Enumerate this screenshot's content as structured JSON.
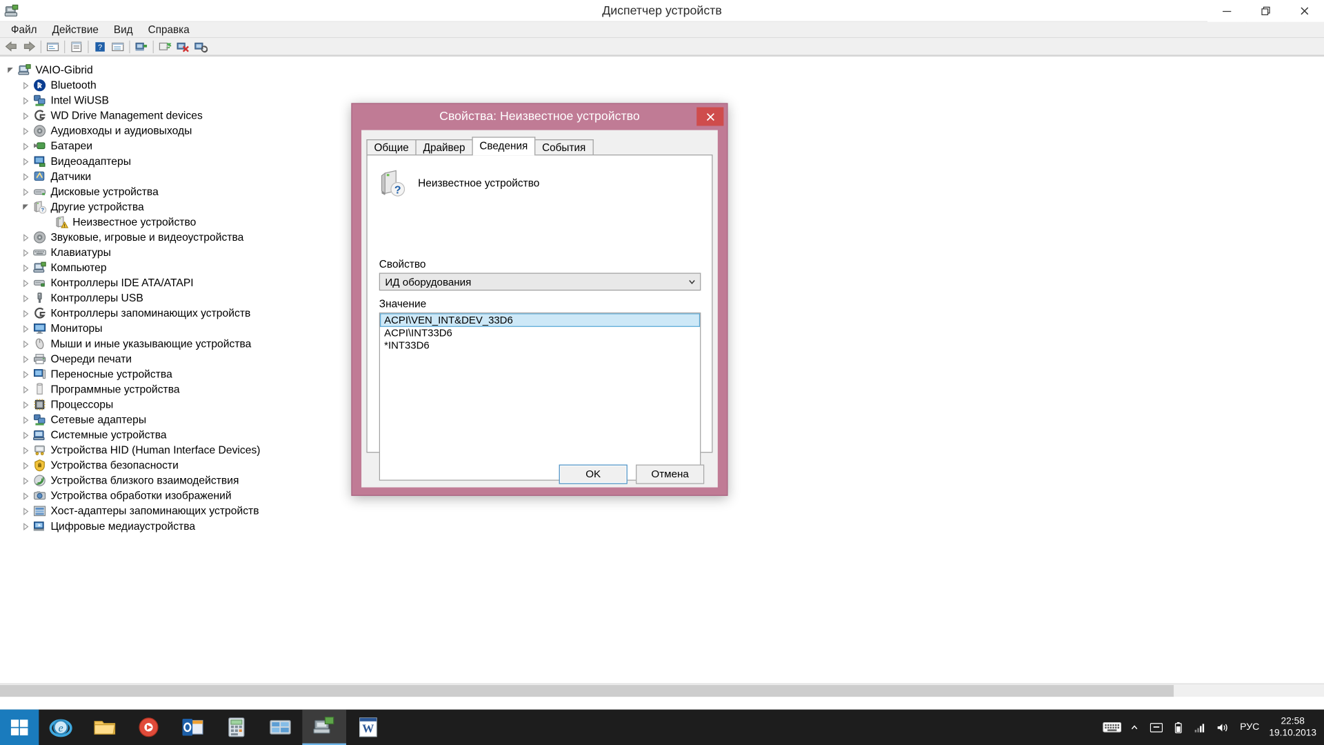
{
  "window": {
    "title": "Диспетчер устройств",
    "icon": "device-manager-icon",
    "minimize_label": "—",
    "restore_label": "❐",
    "close_label": "✕"
  },
  "menubar": {
    "items": [
      {
        "label": "Файл",
        "name": "menu-file"
      },
      {
        "label": "Действие",
        "name": "menu-action"
      },
      {
        "label": "Вид",
        "name": "menu-view"
      },
      {
        "label": "Справка",
        "name": "menu-help"
      }
    ]
  },
  "toolbar": {
    "buttons": [
      {
        "name": "back-icon",
        "title": "Назад"
      },
      {
        "name": "forward-icon",
        "title": "Вперед"
      },
      {
        "name": "show-hide-console-tree-icon",
        "title": "Показать/скрыть дерево консоли"
      },
      {
        "name": "properties-icon",
        "title": "Свойства"
      },
      {
        "name": "help-icon",
        "title": "Справка"
      },
      {
        "name": "show-hide-pane-icon",
        "title": "Показать/скрыть область"
      },
      {
        "name": "scan-hardware-changes-icon",
        "title": "Обновить конфигурацию оборудования"
      },
      {
        "name": "update-driver-icon",
        "title": "Обновить драйверы"
      },
      {
        "name": "disable-device-icon",
        "title": "Отключить устройство"
      },
      {
        "name": "uninstall-device-icon",
        "title": "Удалить устройство"
      }
    ]
  },
  "tree": {
    "nodes": [
      {
        "label": "VAIO-Gibrid",
        "level": 0,
        "expander": "expanded",
        "icon": "computer-icon"
      },
      {
        "label": "Bluetooth",
        "level": 1,
        "expander": "collapsed",
        "icon": "bluetooth-icon"
      },
      {
        "label": "Intel WiUSB",
        "level": 1,
        "expander": "collapsed",
        "icon": "network-adapter-icon"
      },
      {
        "label": "WD Drive Management devices",
        "level": 1,
        "expander": "collapsed",
        "icon": "storage-controller-icon"
      },
      {
        "label": "Аудиовходы и аудиовыходы",
        "level": 1,
        "expander": "collapsed",
        "icon": "audio-icon"
      },
      {
        "label": "Батареи",
        "level": 1,
        "expander": "collapsed",
        "icon": "battery-icon"
      },
      {
        "label": "Видеоадаптеры",
        "level": 1,
        "expander": "collapsed",
        "icon": "display-adapter-icon"
      },
      {
        "label": "Датчики",
        "level": 1,
        "expander": "collapsed",
        "icon": "sensor-icon"
      },
      {
        "label": "Дисковые устройства",
        "level": 1,
        "expander": "collapsed",
        "icon": "disk-drive-icon"
      },
      {
        "label": "Другие устройства",
        "level": 1,
        "expander": "expanded",
        "icon": "other-device-icon"
      },
      {
        "label": "Неизвестное устройство",
        "level": 2,
        "expander": "none",
        "icon": "unknown-device-icon",
        "selected": false
      },
      {
        "label": "Звуковые, игровые и видеоустройства",
        "level": 1,
        "expander": "collapsed",
        "icon": "audio-icon"
      },
      {
        "label": "Клавиатуры",
        "level": 1,
        "expander": "collapsed",
        "icon": "keyboard-icon"
      },
      {
        "label": "Компьютер",
        "level": 1,
        "expander": "collapsed",
        "icon": "computer-icon"
      },
      {
        "label": "Контроллеры IDE ATA/ATAPI",
        "level": 1,
        "expander": "collapsed",
        "icon": "ide-controller-icon"
      },
      {
        "label": "Контроллеры USB",
        "level": 1,
        "expander": "collapsed",
        "icon": "usb-icon"
      },
      {
        "label": "Контроллеры запоминающих устройств",
        "level": 1,
        "expander": "collapsed",
        "icon": "storage-controller-icon"
      },
      {
        "label": "Мониторы",
        "level": 1,
        "expander": "collapsed",
        "icon": "monitor-icon"
      },
      {
        "label": "Мыши и иные указывающие устройства",
        "level": 1,
        "expander": "collapsed",
        "icon": "mouse-icon"
      },
      {
        "label": "Очереди печати",
        "level": 1,
        "expander": "collapsed",
        "icon": "printer-icon"
      },
      {
        "label": "Переносные устройства",
        "level": 1,
        "expander": "collapsed",
        "icon": "portable-device-icon"
      },
      {
        "label": "Программные устройства",
        "level": 1,
        "expander": "collapsed",
        "icon": "software-device-icon"
      },
      {
        "label": "Процессоры",
        "level": 1,
        "expander": "collapsed",
        "icon": "processor-icon"
      },
      {
        "label": "Сетевые адаптеры",
        "level": 1,
        "expander": "collapsed",
        "icon": "network-adapter-icon"
      },
      {
        "label": "Системные устройства",
        "level": 1,
        "expander": "collapsed",
        "icon": "system-device-icon"
      },
      {
        "label": "Устройства HID (Human Interface Devices)",
        "level": 1,
        "expander": "collapsed",
        "icon": "hid-icon"
      },
      {
        "label": "Устройства безопасности",
        "level": 1,
        "expander": "collapsed",
        "icon": "security-device-icon"
      },
      {
        "label": "Устройства близкого взаимодействия",
        "level": 1,
        "expander": "collapsed",
        "icon": "nfc-icon"
      },
      {
        "label": "Устройства обработки изображений",
        "level": 1,
        "expander": "collapsed",
        "icon": "imaging-device-icon"
      },
      {
        "label": "Хост-адаптеры запоминающих устройств",
        "level": 1,
        "expander": "collapsed",
        "icon": "storage-host-icon"
      },
      {
        "label": "Цифровые медиаустройства",
        "level": 1,
        "expander": "collapsed",
        "icon": "media-device-icon"
      }
    ]
  },
  "dialog": {
    "title": "Свойства: Неизвестное устройство",
    "close_label": "✕",
    "tabs": [
      {
        "label": "Общие",
        "name": "tab-general",
        "active": false
      },
      {
        "label": "Драйвер",
        "name": "tab-driver",
        "active": false
      },
      {
        "label": "Сведения",
        "name": "tab-details",
        "active": true
      },
      {
        "label": "События",
        "name": "tab-events",
        "active": false
      }
    ],
    "device_name": "Неизвестное устройство",
    "device_icon": "unknown-device-large-icon",
    "property_label": "Свойство",
    "property_value": "ИД оборудования",
    "value_label": "Значение",
    "values": [
      {
        "text": "ACPI\\VEN_INT&DEV_33D6",
        "selected": true
      },
      {
        "text": "ACPI\\INT33D6",
        "selected": false
      },
      {
        "text": "*INT33D6",
        "selected": false
      }
    ],
    "ok_label": "OK",
    "cancel_label": "Отмена"
  },
  "taskbar": {
    "start_label": "start-button",
    "apps": [
      {
        "name": "taskbar-internet-explorer",
        "icon": "internet-explorer-icon",
        "active": false
      },
      {
        "name": "taskbar-file-explorer",
        "icon": "folder-icon",
        "active": false
      },
      {
        "name": "taskbar-media-player",
        "icon": "media-player-icon",
        "active": false
      },
      {
        "name": "taskbar-outlook",
        "icon": "outlook-icon",
        "active": false
      },
      {
        "name": "taskbar-calculator",
        "icon": "calculator-icon",
        "active": false
      },
      {
        "name": "taskbar-control-panel",
        "icon": "control-panel-icon",
        "active": false
      },
      {
        "name": "taskbar-device-manager",
        "icon": "device-manager-icon",
        "active": true
      },
      {
        "name": "taskbar-word",
        "icon": "word-icon",
        "active": false
      }
    ],
    "tray": {
      "keyboard_icon": "keyboard-icon",
      "show_hidden_icon": "chevron-up-icon",
      "action_center_icon": "action-center-icon",
      "battery_icon": "battery-icon",
      "network_icon": "network-signal-icon",
      "volume_icon": "speaker-icon",
      "language": "РУС",
      "time": "22:58",
      "date": "19.10.2013"
    }
  },
  "colors": {
    "dialog_frame": "#c07b95",
    "titlebar_bg": "#ffffff",
    "selection": "#cde8f7",
    "start_button": "#1a7bbd",
    "taskbar": "#1d1d1d"
  }
}
